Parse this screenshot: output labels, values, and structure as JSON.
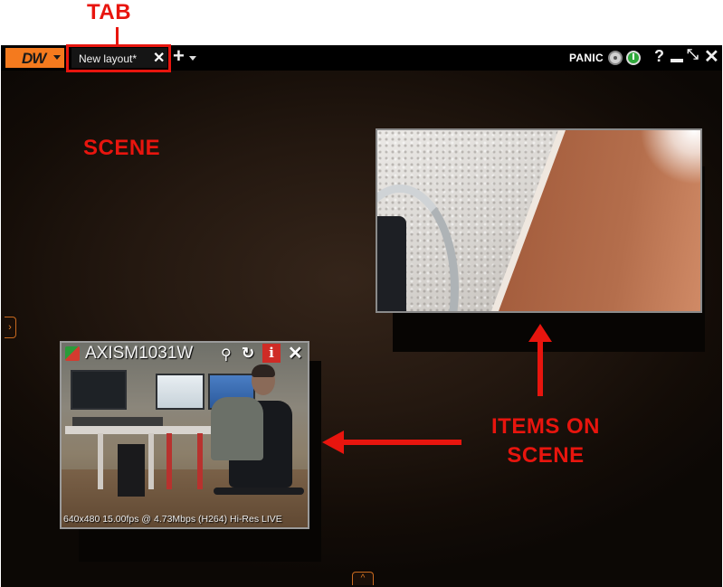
{
  "annotations": {
    "tab_label": "TAB",
    "scene_label": "SCENE",
    "items_label_line1": "ITEMS ON",
    "items_label_line2": "SCENE",
    "annotation_color": "#e8150e"
  },
  "title_bar": {
    "logo_text": "DW",
    "tab_label": "New layout*",
    "tab_close": "✕",
    "add_tab": "+",
    "panic_label": "PANIC",
    "help_label": "?",
    "fullscreen_label": "⤡",
    "close_label": "✕"
  },
  "scene": {
    "side_toggle": "›",
    "bottom_toggle": "^",
    "camera_2": {
      "name": "AXISM1031W",
      "zoom_icon": "⚲",
      "rotate_icon": "↻",
      "info_label": "i",
      "close_label": "✕",
      "footer": "640x480 15.00fps @ 4.73Mbps (H264) Hi-Res  LIVE"
    }
  },
  "colors": {
    "accent_orange": "#f47a1e",
    "info_red": "#cf2b26",
    "power_green": "#2fa83b",
    "title_bar_bg": "#000000"
  }
}
